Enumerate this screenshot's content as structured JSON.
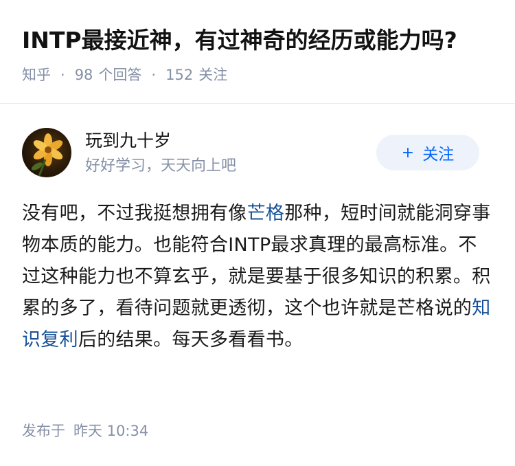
{
  "question": {
    "title": "INTP最接近神，有过神奇的经历或能力吗?",
    "source": "知乎",
    "answers_count": "98",
    "answers_label": "个回答",
    "follows_count": "152",
    "follows_label": "关注"
  },
  "author": {
    "name": "玩到九十岁",
    "bio": "好好学习，天天向上吧",
    "follow_label": "关注",
    "follow_icon": "plus-icon"
  },
  "answer": {
    "part1": "没有吧，不过我挺想拥有像",
    "link1": "芒格",
    "part2": "那种，短时间就能洞穿事物本质的能力。也能符合INTP最求真理的最高标准。不过这种能力也不算玄乎，就是要基于很多知识的积累。积累的多了，看待问题就更透彻，这个也许就是芒格说的",
    "link2": "知识复利",
    "part3": "后的结果。每天多看看书。"
  },
  "footer": {
    "published_label": "发布于",
    "published_time": "昨天 10:34"
  },
  "colors": {
    "meta": "#8590a6",
    "link": "#175199",
    "accent": "#0066ff",
    "button_bg": "#eef3fb"
  }
}
